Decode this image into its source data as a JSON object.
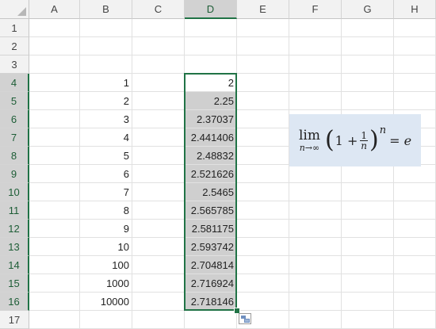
{
  "columns": [
    "A",
    "B",
    "C",
    "D",
    "E",
    "F",
    "G",
    "H"
  ],
  "rows": [
    "1",
    "2",
    "3",
    "4",
    "5",
    "6",
    "7",
    "8",
    "9",
    "10",
    "11",
    "12",
    "13",
    "14",
    "15",
    "16",
    "17"
  ],
  "selected_column": "D",
  "selected_rows": [
    "4",
    "5",
    "6",
    "7",
    "8",
    "9",
    "10",
    "11",
    "12",
    "13",
    "14",
    "15",
    "16"
  ],
  "column_b_values": [
    "1",
    "2",
    "3",
    "4",
    "5",
    "6",
    "7",
    "8",
    "9",
    "10",
    "100",
    "1000",
    "10000"
  ],
  "column_d_values": [
    "2",
    "2.25",
    "2.37037",
    "2.441406",
    "2.48832",
    "2.521626",
    "2.5465",
    "2.565785",
    "2.581175",
    "2.593742",
    "2.704814",
    "2.716924",
    "2.718146"
  ],
  "formula": {
    "lim": "lim",
    "lim_sub": "n→∞",
    "open_paren": "(",
    "one": "1 +",
    "frac_num": "1",
    "frac_den": "n",
    "close_paren": ")",
    "exponent": "n",
    "equals_e": "= e"
  },
  "colors": {
    "selection": "#217346",
    "header_bg": "#f2f2f2",
    "selected_header_bg": "#d2d2d2",
    "range_shade": "#cfcfcf",
    "formula_bg": "#dde7f3"
  },
  "icons": [
    "quick-analysis-icon",
    "select-all-icon"
  ]
}
